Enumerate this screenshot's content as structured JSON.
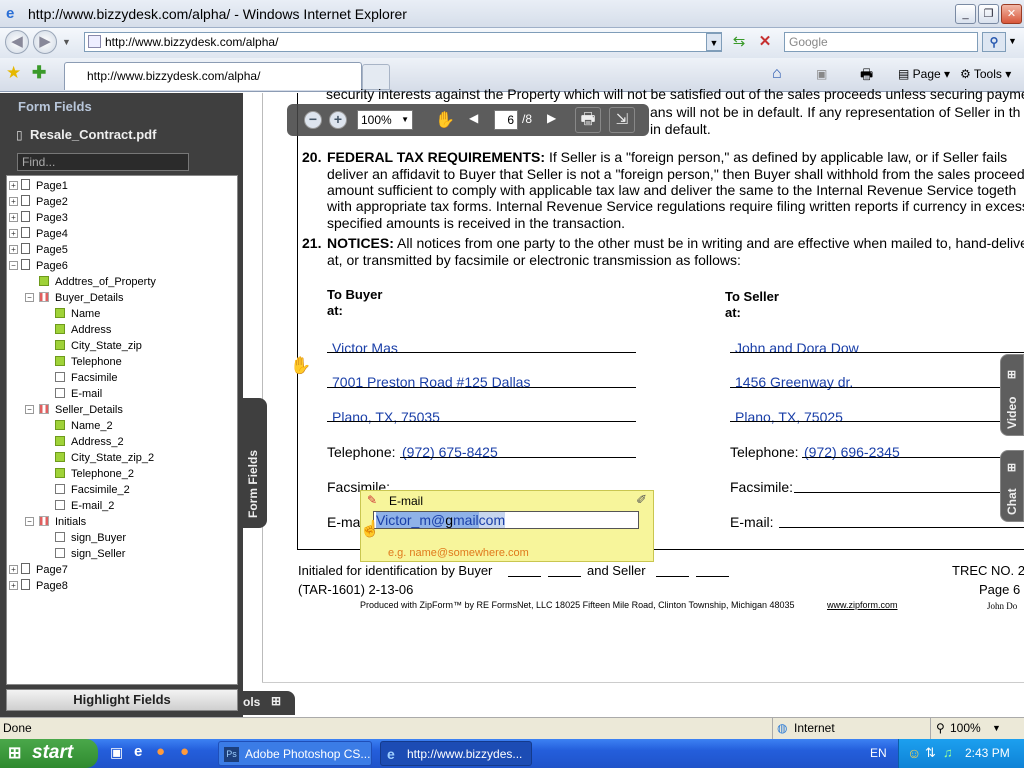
{
  "window": {
    "title": "http://www.bizzydesk.com/alpha/ - Windows Internet Explorer"
  },
  "browser": {
    "address": "http://www.bizzydesk.com/alpha/",
    "search_placeholder": "Google",
    "tab_label": "http://www.bizzydesk.com/alpha/",
    "page_menu": "Page",
    "tools_menu": "Tools"
  },
  "panel": {
    "title": "Form Fields",
    "file_name": "Resale_Contract.pdf",
    "find_placeholder": "Find...",
    "highlight_button": "Highlight Fields",
    "vertical_tab": "Form Fields",
    "tools_tab": "ols",
    "tree": [
      {
        "label": "Page1",
        "level": 0,
        "type": "page",
        "expander": "+"
      },
      {
        "label": "Page2",
        "level": 0,
        "type": "page",
        "expander": "+"
      },
      {
        "label": "Page3",
        "level": 0,
        "type": "page",
        "expander": "+"
      },
      {
        "label": "Page4",
        "level": 0,
        "type": "page",
        "expander": "+"
      },
      {
        "label": "Page5",
        "level": 0,
        "type": "page",
        "expander": "+"
      },
      {
        "label": "Page6",
        "level": 0,
        "type": "page",
        "expander": "-"
      },
      {
        "label": "Addtres_of_Property",
        "level": 1,
        "type": "filled"
      },
      {
        "label": "Buyer_Details",
        "level": 1,
        "type": "group",
        "expander": "-"
      },
      {
        "label": "Name",
        "level": 2,
        "type": "filled"
      },
      {
        "label": "Address",
        "level": 2,
        "type": "filled"
      },
      {
        "label": "City_State_zip",
        "level": 2,
        "type": "filled"
      },
      {
        "label": "Telephone",
        "level": 2,
        "type": "filled"
      },
      {
        "label": "Facsimile",
        "level": 2,
        "type": "empty"
      },
      {
        "label": "E-mail",
        "level": 2,
        "type": "empty"
      },
      {
        "label": "Seller_Details",
        "level": 1,
        "type": "group",
        "expander": "-"
      },
      {
        "label": "Name_2",
        "level": 2,
        "type": "filled"
      },
      {
        "label": "Address_2",
        "level": 2,
        "type": "filled"
      },
      {
        "label": "City_State_zip_2",
        "level": 2,
        "type": "filled"
      },
      {
        "label": "Telephone_2",
        "level": 2,
        "type": "filled"
      },
      {
        "label": "Facsimile_2",
        "level": 2,
        "type": "empty"
      },
      {
        "label": "E-mail_2",
        "level": 2,
        "type": "empty"
      },
      {
        "label": "Initials",
        "level": 1,
        "type": "group",
        "expander": "-"
      },
      {
        "label": "sign_Buyer",
        "level": 2,
        "type": "empty"
      },
      {
        "label": "sign_Seller",
        "level": 2,
        "type": "empty"
      },
      {
        "label": "Page7",
        "level": 0,
        "type": "page",
        "expander": "+"
      },
      {
        "label": "Page8",
        "level": 0,
        "type": "page",
        "expander": "+"
      }
    ]
  },
  "viewer": {
    "zoom": "100%",
    "page_current": "6",
    "page_total": "/8"
  },
  "document": {
    "line_top1": "security interests against the Property which will not be satisfied out of the sales proceeds unless securing payme",
    "line_top2": "ans will not be in default. If any representation of Seller in th",
    "line_top3": "in default.",
    "sec20_num": "20.",
    "sec20_head": "FEDERAL TAX REQUIREMENTS:",
    "sec20_l1": "If Seller is a \"foreign person,\" as defined by applicable law, or if Seller fails",
    "sec20_l2": "deliver an affidavit to Buyer that Seller is not a \"foreign person,\" then Buyer shall withhold from the sales proceeds",
    "sec20_l3": "amount sufficient to comply with applicable tax law and deliver the same to the Internal Revenue Service togeth",
    "sec20_l4": "with appropriate tax forms. Internal Revenue Service regulations require filing written reports if currency in excess",
    "sec20_l5": "specified amounts is received in the transaction.",
    "sec21_num": "21.",
    "sec21_head": "NOTICES:",
    "sec21_l1": "All notices from one party to the other must be in writing and are effective when mailed to, hand-deliver",
    "sec21_l2": "at, or transmitted by facsimile or electronic transmission as follows:",
    "buyer_head": "To Buyer",
    "seller_head": "To Seller",
    "at": "at:",
    "buyer_name": "Victor Mas",
    "buyer_address": "7001 Preston Road #125 Dallas",
    "buyer_city": "Plano, TX, 75035",
    "buyer_phone": "(972) 675-8425",
    "seller_name": "John and Dora Dow",
    "seller_address": "1456 Greenway dr.",
    "seller_city": "Plano, TX, 75025",
    "seller_phone": "(972) 696-2345",
    "telephone_label": "Telephone:",
    "facsimile_label": "Facsimile:",
    "email_label": "E-mail:",
    "buyer_email_label_partial": "E-ma",
    "initials_line": "Initialed for identification by Buyer",
    "and_seller": "and Seller",
    "trec": "TREC NO. 2",
    "tar": "(TAR-1601) 2-13-06",
    "page_label": "Page 6",
    "produced": "Produced with ZipForm™ by RE FormsNet, LLC 18025 Fifteen Mile Road, Clinton Township, Michigan 48035",
    "zipform_link": "www.zipform.com",
    "john_do": "John Do"
  },
  "popup": {
    "title": "E-mail",
    "value_selected": "Victor_m@",
    "value_cursor": "g",
    "value_rest": "mail",
    "value_tail": "com",
    "example": "e.g. name@somewhere.com"
  },
  "side_tabs": {
    "video": "Video",
    "chat": "Chat"
  },
  "status": {
    "left": "Done",
    "zone": "Internet",
    "zoom": "100%"
  },
  "taskbar": {
    "start": "start",
    "items": [
      "Adobe Photoshop CS...",
      "http://www.bizzydes..."
    ],
    "lang": "EN",
    "time": "2:43 PM"
  }
}
